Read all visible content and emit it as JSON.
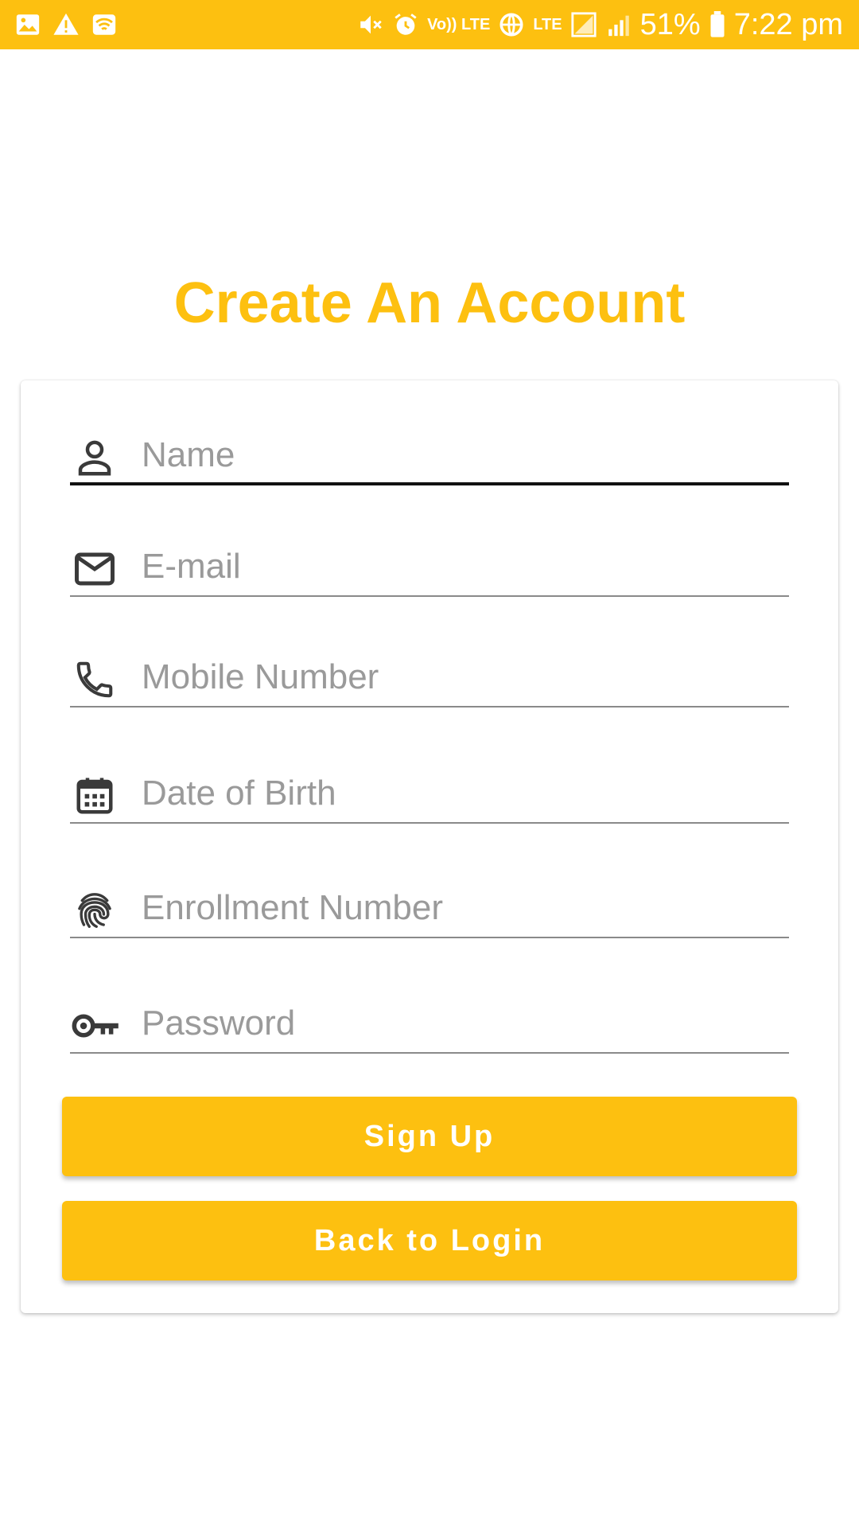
{
  "status_bar": {
    "battery_percent": "51%",
    "time": "7:22 pm",
    "volte_label": "Vo)) LTE",
    "lte_label": "LTE",
    "left_icons": [
      "image-icon",
      "warning-icon",
      "wifi-icon"
    ],
    "right_icons": [
      "mute-icon",
      "alarm-icon",
      "volte-icon",
      "data-saver-icon",
      "lte-signal-icon",
      "signal-icon",
      "battery-icon"
    ],
    "background_color": "#FDC010"
  },
  "page": {
    "title": "Create An Account",
    "accent_color": "#FDC010"
  },
  "form": {
    "fields": [
      {
        "placeholder": "Name",
        "value": "",
        "icon": "person-icon"
      },
      {
        "placeholder": "E-mail",
        "value": "",
        "icon": "mail-icon"
      },
      {
        "placeholder": "Mobile Number",
        "value": "",
        "icon": "phone-icon"
      },
      {
        "placeholder": "Date of Birth",
        "value": "",
        "icon": "calendar-icon"
      },
      {
        "placeholder": "Enrollment Number",
        "value": "",
        "icon": "fingerprint-icon"
      },
      {
        "placeholder": "Password",
        "value": "",
        "icon": "key-icon"
      }
    ],
    "signup_label": "Sign Up",
    "back_label": "Back to Login"
  }
}
